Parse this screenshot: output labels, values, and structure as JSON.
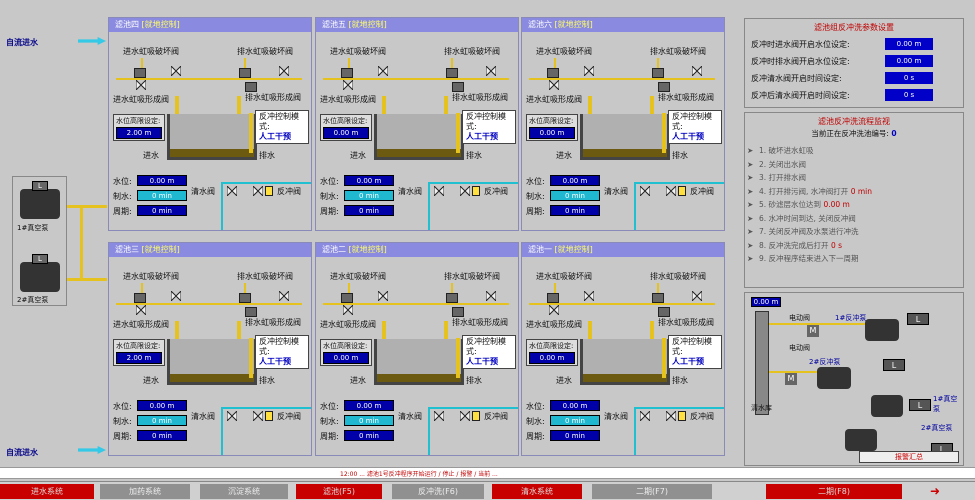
{
  "left": {
    "water_in_label": "自流进水",
    "water_out_label": "自流进水",
    "top_motor": {
      "label": "1#真空泵",
      "button": "L"
    },
    "bottom_motor": {
      "label": "2#真空泵",
      "button": "L"
    }
  },
  "filters": [
    {
      "title": "滤池四",
      "mode_tag": "[就地控制]",
      "valve_in": "进水虹吸破坏阀",
      "valve_out": "排水虹吸破坏阀",
      "siphon_in": "进水虹吸形成阀",
      "siphon_out": "排水虹吸形成阀",
      "set_label": "水位高限设定:",
      "set_value": "2.00 m",
      "backwash_label": "反冲控制模式:",
      "backwash_mode": "人工干预",
      "inlet": "进水",
      "drain": "排水",
      "level_label": "水位:",
      "level_value": "0.00 m",
      "prod_label": "制水:",
      "prod_value": "0 min",
      "cycle_label": "周期:",
      "cycle_value": "0 min",
      "clean_valve": "清水阀",
      "backwash_valve": "反冲阀"
    },
    {
      "title": "滤池五",
      "mode_tag": "[就地控制]",
      "valve_in": "进水虹吸破坏阀",
      "valve_out": "排水虹吸破坏阀",
      "siphon_in": "进水虹吸形成阀",
      "siphon_out": "排水虹吸形成阀",
      "set_label": "水位高限设定:",
      "set_value": "0.00 m",
      "backwash_label": "反冲控制模式:",
      "backwash_mode": "人工干预",
      "inlet": "进水",
      "drain": "排水",
      "level_label": "水位:",
      "level_value": "0.00 m",
      "prod_label": "制水:",
      "prod_value": "0 min",
      "cycle_label": "周期:",
      "cycle_value": "0 min",
      "clean_valve": "清水阀",
      "backwash_valve": "反冲阀"
    },
    {
      "title": "滤池六",
      "mode_tag": "[就地控制]",
      "valve_in": "进水虹吸破坏阀",
      "valve_out": "排水虹吸破坏阀",
      "siphon_in": "进水虹吸形成阀",
      "siphon_out": "排水虹吸形成阀",
      "set_label": "水位高限设定:",
      "set_value": "0.00 m",
      "backwash_label": "反冲控制模式:",
      "backwash_mode": "人工干预",
      "inlet": "进水",
      "drain": "排水",
      "level_label": "水位:",
      "level_value": "0.00 m",
      "prod_label": "制水:",
      "prod_value": "0 min",
      "cycle_label": "周期:",
      "cycle_value": "0 min",
      "clean_valve": "清水阀",
      "backwash_valve": "反冲阀"
    },
    {
      "title": "滤池三",
      "mode_tag": "[就地控制]",
      "valve_in": "进水虹吸破坏阀",
      "valve_out": "排水虹吸破坏阀",
      "siphon_in": "进水虹吸形成阀",
      "siphon_out": "排水虹吸形成阀",
      "set_label": "水位高限设定:",
      "set_value": "2.00 m",
      "backwash_label": "反冲控制模式:",
      "backwash_mode": "人工干预",
      "inlet": "进水",
      "drain": "排水",
      "level_label": "水位:",
      "level_value": "0.00 m",
      "prod_label": "制水:",
      "prod_value": "0 min",
      "cycle_label": "周期:",
      "cycle_value": "0 min",
      "clean_valve": "清水阀",
      "backwash_valve": "反冲阀"
    },
    {
      "title": "滤池二",
      "mode_tag": "[就地控制]",
      "valve_in": "进水虹吸破坏阀",
      "valve_out": "排水虹吸破坏阀",
      "siphon_in": "进水虹吸形成阀",
      "siphon_out": "排水虹吸形成阀",
      "set_label": "水位高限设定:",
      "set_value": "0.00 m",
      "backwash_label": "反冲控制模式:",
      "backwash_mode": "人工干预",
      "inlet": "进水",
      "drain": "排水",
      "level_label": "水位:",
      "level_value": "0.00 m",
      "prod_label": "制水:",
      "prod_value": "0 min",
      "cycle_label": "周期:",
      "cycle_value": "0 min",
      "clean_valve": "清水阀",
      "backwash_valve": "反冲阀"
    },
    {
      "title": "滤池一",
      "mode_tag": "[就地控制]",
      "valve_in": "进水虹吸破坏阀",
      "valve_out": "排水虹吸破坏阀",
      "siphon_in": "进水虹吸形成阀",
      "siphon_out": "排水虹吸形成阀",
      "set_label": "水位高限设定:",
      "set_value": "0.00 m",
      "backwash_label": "反冲控制模式:",
      "backwash_mode": "人工干预",
      "inlet": "进水",
      "drain": "排水",
      "level_label": "水位:",
      "level_value": "0.00 m",
      "prod_label": "制水:",
      "prod_value": "0 min",
      "cycle_label": "周期:",
      "cycle_value": "0 min",
      "clean_valve": "清水阀",
      "backwash_valve": "反冲阀"
    }
  ],
  "params": {
    "title": "滤池组反冲洗参数设置",
    "rows": [
      {
        "label": "反冲时进水阀开启水位设定:",
        "value": "0.00 m"
      },
      {
        "label": "反冲时排水阀开启水位设定:",
        "value": "0.00 m"
      },
      {
        "label": "反冲清水阀开启时间设定:",
        "value": "0 s"
      },
      {
        "label": "反冲后清水阀开启时间设定:",
        "value": "0 s"
      }
    ]
  },
  "process": {
    "title": "滤池反冲洗流程监视",
    "subtitle": "当前正在反冲洗池编号:",
    "current_id": "0",
    "steps": [
      "1. 破坏进水虹吸",
      "2. 关闭出水阀",
      "3. 打开排水阀",
      "4. 打开排污阀, 水冲阀打开",
      "5. 砂滤层水位达到",
      "6. 水冲时间到达, 关闭反冲阀",
      "7. 关闭反冲阀及水泵进行冲洗",
      "8. 反冲洗完成后打开",
      "9. 反冲程序结束进入下一周期"
    ],
    "step4_value": "0 min",
    "step5_value": "0.00 m",
    "step8_value": "0 s"
  },
  "pumps": {
    "level_value": "0.00 m",
    "motor_valve1": "电动阀",
    "motor_valve2": "电动阀",
    "pump1": "1#反冲泵",
    "pump2": "2#反冲泵",
    "clean_tank": "清水库",
    "vacuum1": "1#真空泵",
    "vacuum2": "2#真空泵",
    "alarm_button": "报警汇总"
  },
  "status_text": "12:00 ... 滤池1号反冲程序开始运行 / 停止 / 报警 / 当前 ...",
  "bottom": [
    {
      "label": "进水系统",
      "style": "red"
    },
    {
      "label": "加药系统",
      "style": "gray"
    },
    {
      "label": "沉淀系统",
      "style": "gray"
    },
    {
      "label": "滤池(F5)",
      "style": "red"
    },
    {
      "label": "反冲洗(F6)",
      "style": "gray"
    },
    {
      "label": "清水系统",
      "style": "red"
    },
    {
      "label": "二期(F7)",
      "style": "gray"
    },
    {
      "label": "二期(F8)",
      "style": "red"
    }
  ]
}
